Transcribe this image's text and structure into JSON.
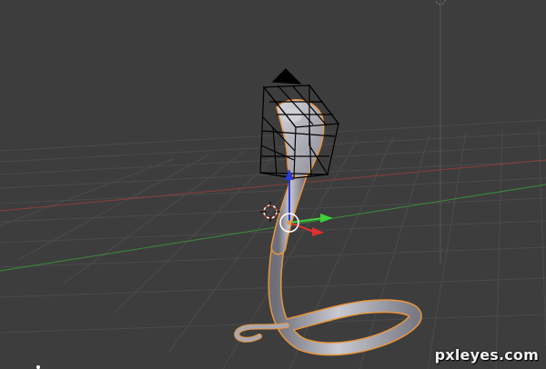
{
  "watermark": {
    "text": "pxleyes.com"
  },
  "colors": {
    "background": "#3d3d3d",
    "grid_line": "#4a4a4a",
    "x_axis": "#9a3b3b",
    "y_axis": "#3e8a3e",
    "selection_outline": "#e8963f",
    "body": "#9a9aa6",
    "lattice": "#000000",
    "gizmo_z": "#2a3ad8",
    "gizmo_y": "#3cd23c",
    "gizmo_x": "#e03030",
    "cursor": "#ffffff"
  }
}
